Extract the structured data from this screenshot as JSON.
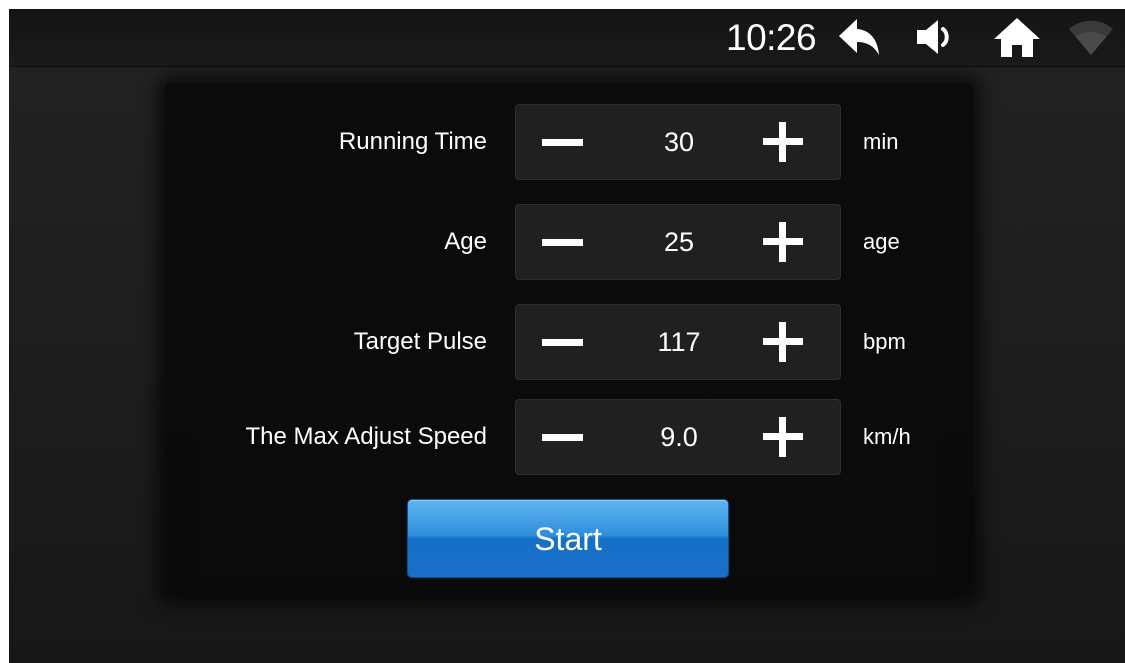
{
  "status_bar": {
    "time": "10:26",
    "icons": [
      "back-icon",
      "volume-icon",
      "home-icon",
      "wifi-icon"
    ]
  },
  "settings": [
    {
      "label": "Running Time",
      "value": "30",
      "unit": "min"
    },
    {
      "label": "Age",
      "value": "25",
      "unit": "age"
    },
    {
      "label": "Target Pulse",
      "value": "117",
      "unit": "bpm"
    },
    {
      "label": "The Max Adjust Speed",
      "value": "9.0",
      "unit": "km/h"
    }
  ],
  "start_button": {
    "label": "Start"
  },
  "colors": {
    "start_button": "#1f7fd4",
    "background": "#1f1f1f",
    "text": "#ffffff"
  }
}
